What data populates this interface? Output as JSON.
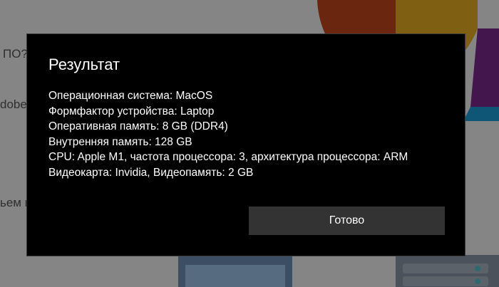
{
  "background": {
    "partial_text_1": "ПО?",
    "partial_text_2": "dobe",
    "partial_text_3": "ьем и"
  },
  "dialog": {
    "title": "Результат",
    "lines": [
      "Операционная система: MacOS",
      "Формфактор устройства: Laptop",
      "Оперативная память: 8 GB (DDR4)",
      "Внутренняя память: 128 GB",
      "CPU: Apple M1, частота процессора: 3, архитектура процессора: ARM",
      "Видеокарта: Invidia, Видеопамять: 2 GB"
    ],
    "done_label": "Готово"
  },
  "colors": {
    "dialog_bg": "#000000",
    "button_bg": "#333333",
    "overlay": "rgba(0,0,0,0.45)"
  }
}
